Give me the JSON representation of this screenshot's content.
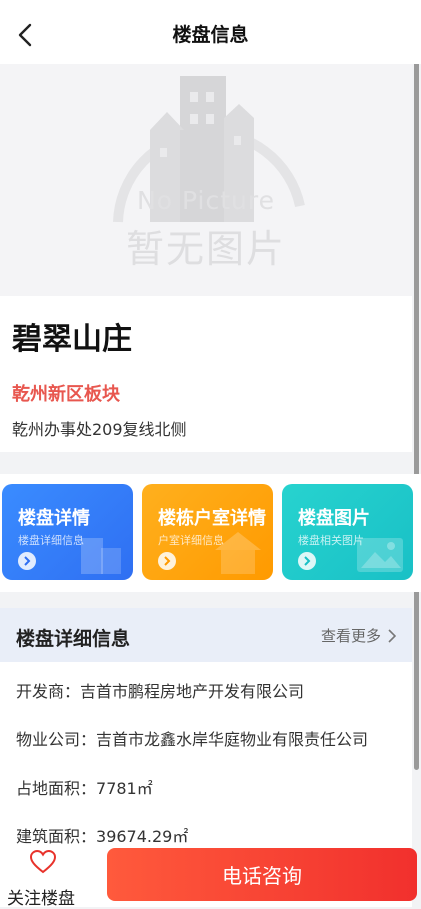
{
  "header": {
    "title": "楼盘信息",
    "back_icon": "chevron-left-icon"
  },
  "hero": {
    "placeholder_en": "No Picture",
    "placeholder_zh": "暂无图片"
  },
  "estate": {
    "name": "碧翠山庄",
    "district": "乾州新区板块",
    "address": "乾州办事处209复线北侧",
    "district_color": "#e8574f"
  },
  "quick_links": [
    {
      "title": "楼盘详情",
      "subtitle": "楼盘详细信息",
      "color": "#3a8cff",
      "icon": "building-icon"
    },
    {
      "title": "楼栋户室详情",
      "subtitle": "户室详细信息",
      "color": "#ffa40f",
      "icon": "house-icon"
    },
    {
      "title": "楼盘图片",
      "subtitle": "楼盘相关图片",
      "color": "#22cccc",
      "icon": "image-icon"
    }
  ],
  "details": {
    "title": "楼盘详细信息",
    "more_label": "查看更多",
    "rows": [
      {
        "label": "开发商：",
        "value": "吉首市鹏程房地产开发有限公司"
      },
      {
        "label": "物业公司：",
        "value": "吉首市龙鑫水岸华庭物业有限责任公司"
      },
      {
        "label": "占地面积：",
        "value": "7781㎡"
      },
      {
        "label": "建筑面积：",
        "value": "39674.29㎡"
      }
    ]
  },
  "bottom": {
    "follow_label": "关注楼盘",
    "call_label": "电话咨询",
    "call_color": "#f4402f"
  }
}
